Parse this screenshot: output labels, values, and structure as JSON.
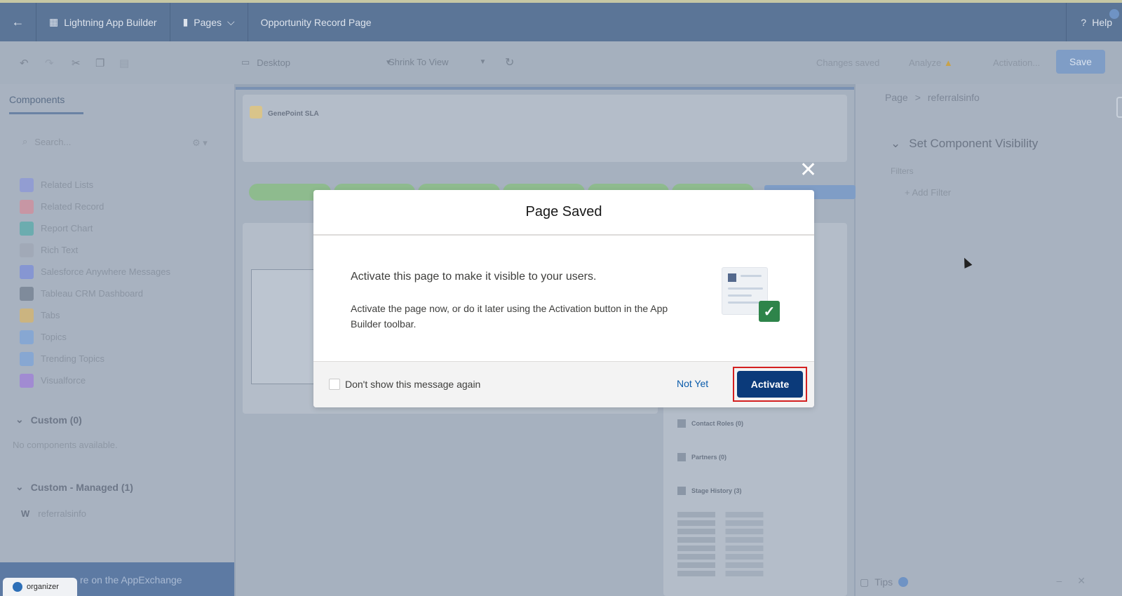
{
  "topbar": {
    "app_label": "Lightning App Builder",
    "pages_label": "Pages",
    "page_title": "Opportunity Record Page",
    "help_label": "Help"
  },
  "toolbar": {
    "device": "Desktop",
    "view": "Shrink To View",
    "status": "Changes saved",
    "analyze": "Analyze",
    "activation": "Activation...",
    "save": "Save"
  },
  "left_panel": {
    "tab": "Components",
    "search_placeholder": "Search...",
    "components": [
      {
        "label": "Related Lists",
        "color": "#7f8ce0"
      },
      {
        "label": "Related Record",
        "color": "#e07f8c"
      },
      {
        "label": "Report Chart",
        "color": "#3aa8a0"
      },
      {
        "label": "Rich Text",
        "color": "#9aa3ae"
      },
      {
        "label": "Salesforce Anywhere Messages",
        "color": "#6a7fe0"
      },
      {
        "label": "Tableau CRM Dashboard",
        "color": "#5d6b7c"
      },
      {
        "label": "Tabs",
        "color": "#e8b74a"
      },
      {
        "label": "Topics",
        "color": "#6b9fe0"
      },
      {
        "label": "Trending Topics",
        "color": "#6b9fe0"
      },
      {
        "label": "Visualforce",
        "color": "#9a6be0"
      }
    ],
    "custom_header": "Custom (0)",
    "custom_empty": "No components available.",
    "managed_header": "Custom - Managed (1)",
    "managed_item": "referralsinfo",
    "appexchange": "re on the AppExchange",
    "org_badge": "organizer"
  },
  "canvas": {
    "record_name": "GenePoint SLA",
    "related": [
      "Contact Roles (0)",
      "Partners (0)",
      "Stage History (3)"
    ]
  },
  "right_panel": {
    "crumb_page": "Page",
    "crumb_sep": ">",
    "crumb_item": "referralsinfo",
    "visibility_title": "Set Component Visibility",
    "filters_label": "Filters",
    "add_filter": "Add Filter",
    "tips": "Tips"
  },
  "modal": {
    "title": "Page Saved",
    "heading": "Activate this page to make it visible to your users.",
    "body": "Activate the page now, or do it later using the Activation button in the App Builder toolbar.",
    "checkbox_label": "Don't show this message again",
    "not_yet": "Not Yet",
    "activate": "Activate"
  }
}
